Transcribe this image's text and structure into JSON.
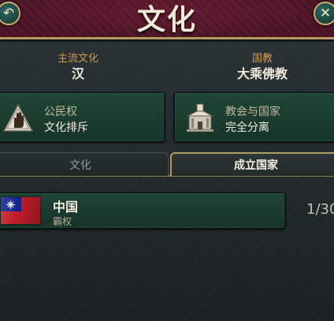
{
  "header": {
    "title": "文化",
    "back_icon": "back-arrow-icon",
    "close_icon": "close-icon"
  },
  "mainstream_culture": {
    "label": "主流文化",
    "value": "汉"
  },
  "state_religion": {
    "label": "国教",
    "value": "大乘佛教"
  },
  "citizenship_card": {
    "icon": "raised-hand-icon",
    "label": "公民权",
    "value": "文化排斥"
  },
  "church_state_card": {
    "icon": "church-building-icon",
    "label": "教会与国家",
    "value": "完全分离"
  },
  "tabs": [
    {
      "label": "文化",
      "selected": false
    },
    {
      "label": "成立国家",
      "selected": true
    }
  ],
  "formable_nations": [
    {
      "name": "中国",
      "subtitle": "霸权",
      "progress": "1/30"
    }
  ],
  "colors": {
    "accent_gold": "#b79a5e",
    "label_orange": "#d69a44",
    "card_green": "#1f4638",
    "header_maroon": "#4a1424"
  }
}
